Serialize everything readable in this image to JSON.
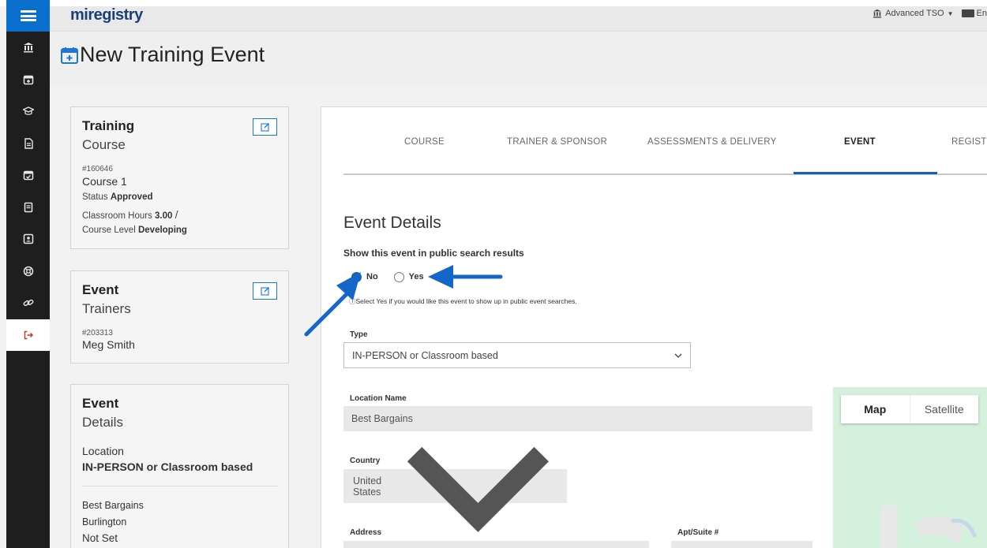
{
  "app": {
    "logo": "miregistry",
    "header_role": "Advanced TSO",
    "header_extra": "En"
  },
  "page": {
    "title": "New Training Event"
  },
  "sidebar": {
    "items": [
      {
        "icon": "bank-icon"
      },
      {
        "icon": "calendar-plus-icon"
      },
      {
        "icon": "graduation-cap-icon"
      },
      {
        "icon": "document-icon"
      },
      {
        "icon": "calendar-check-icon"
      },
      {
        "icon": "book-icon"
      },
      {
        "icon": "contact-card-icon"
      },
      {
        "icon": "life-ring-icon"
      },
      {
        "icon": "link-icon"
      },
      {
        "icon": "logout-icon"
      }
    ]
  },
  "training_card": {
    "title": "Training",
    "subtitle": "Course",
    "id": "#160646",
    "name": "Course 1",
    "status_label": "Status",
    "status_value": "Approved",
    "hours_label": "Classroom Hours",
    "hours_value": "3.00",
    "separator": "/",
    "level_label": "Course Level",
    "level_value": "Developing"
  },
  "trainers_card": {
    "title": "Event",
    "subtitle": "Trainers",
    "id": "#203313",
    "name": "Meg Smith"
  },
  "details_card": {
    "title": "Event",
    "subtitle": "Details",
    "location_label": "Location",
    "location_value": "IN-PERSON or Classroom based",
    "place": "Best Bargains",
    "city": "Burlington",
    "extra": "Not Set"
  },
  "tabs": [
    {
      "label": "COURSE"
    },
    {
      "label": "TRAINER & SPONSOR"
    },
    {
      "label": "ASSESSMENTS & DELIVERY"
    },
    {
      "label": "EVENT",
      "active": true
    },
    {
      "label": "REGIST"
    }
  ],
  "form": {
    "section_title": "Event Details",
    "public_question": "Show this event in public search results",
    "option_no": "No",
    "option_yes": "Yes",
    "selected": "No",
    "hint": "Select Yes if you would like this event to show up in public event searches.",
    "type_label": "Type",
    "type_value": "IN-PERSON or Classroom based",
    "location_name_label": "Location Name",
    "location_name_value": "Best Bargains",
    "country_label": "Country",
    "country_value": "United States",
    "address_label": "Address",
    "apt_label": "Apt/Suite #"
  },
  "map": {
    "tab_map": "Map",
    "tab_satellite": "Satellite"
  },
  "colors": {
    "accent": "#1c5fb0",
    "menu": "#0b6fd0",
    "sidebar": "#1e1e1e",
    "arrow": "#1466c8"
  }
}
